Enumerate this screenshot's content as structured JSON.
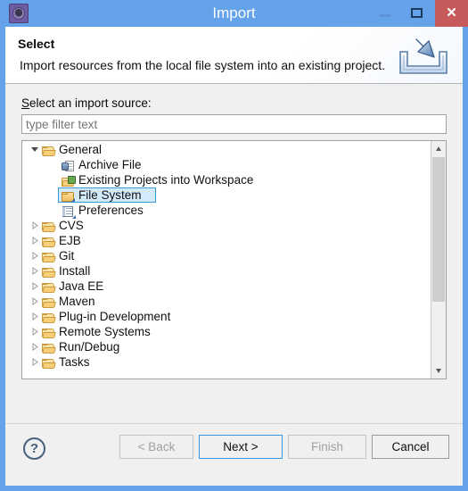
{
  "window": {
    "title": "Import",
    "app_icon": "eclipse-gear-icon",
    "controls": {
      "minimize": "minimize-icon",
      "maximize": "maximize-icon",
      "close": "✕"
    },
    "colors": {
      "titlebar": "#64a2ea",
      "close_button": "#c75b5b",
      "selection_fill": "#d3eafb",
      "selection_border": "#3a9ad9",
      "default_button_border": "#3399e6",
      "body": "#f0f0f0"
    }
  },
  "header": {
    "title": "Select",
    "description": "Import resources from the local file system into an existing project.",
    "banner_icon": "import-arrow-into-tray-icon"
  },
  "source": {
    "label_prefix": "S",
    "label_rest": "elect an import source:",
    "filter_placeholder": "type filter text",
    "filter_value": ""
  },
  "tree": {
    "items": [
      {
        "label": "General",
        "indent": 0,
        "icon": "open-folder-icon",
        "state": "expanded",
        "selected": false
      },
      {
        "label": "Archive File",
        "indent": 1,
        "icon": "archive-file-icon",
        "state": "leaf",
        "selected": false
      },
      {
        "label": "Existing Projects into Workspace",
        "indent": 1,
        "icon": "projects-folder-icon",
        "state": "leaf",
        "selected": false
      },
      {
        "label": "File System",
        "indent": 1,
        "icon": "file-system-folder-icon",
        "state": "leaf",
        "selected": true
      },
      {
        "label": "Preferences",
        "indent": 1,
        "icon": "preferences-doc-icon",
        "state": "leaf",
        "selected": false
      },
      {
        "label": "CVS",
        "indent": 0,
        "icon": "open-folder-icon",
        "state": "collapsed",
        "selected": false
      },
      {
        "label": "EJB",
        "indent": 0,
        "icon": "open-folder-icon",
        "state": "collapsed",
        "selected": false
      },
      {
        "label": "Git",
        "indent": 0,
        "icon": "open-folder-icon",
        "state": "collapsed",
        "selected": false
      },
      {
        "label": "Install",
        "indent": 0,
        "icon": "open-folder-icon",
        "state": "collapsed",
        "selected": false
      },
      {
        "label": "Java EE",
        "indent": 0,
        "icon": "open-folder-icon",
        "state": "collapsed",
        "selected": false
      },
      {
        "label": "Maven",
        "indent": 0,
        "icon": "open-folder-icon",
        "state": "collapsed",
        "selected": false
      },
      {
        "label": "Plug-in Development",
        "indent": 0,
        "icon": "open-folder-icon",
        "state": "collapsed",
        "selected": false
      },
      {
        "label": "Remote Systems",
        "indent": 0,
        "icon": "open-folder-icon",
        "state": "collapsed",
        "selected": false
      },
      {
        "label": "Run/Debug",
        "indent": 0,
        "icon": "open-folder-icon",
        "state": "collapsed",
        "selected": false
      },
      {
        "label": "Tasks",
        "indent": 0,
        "icon": "open-folder-icon",
        "state": "collapsed",
        "selected": false
      }
    ],
    "scrollbar": {
      "up_arrow": "chevron-up-icon",
      "down_arrow": "chevron-down-icon"
    }
  },
  "footer": {
    "help": "?",
    "back": {
      "label": "< Back",
      "mnemonic": "B",
      "enabled": false,
      "default": false
    },
    "next": {
      "label": "Next >",
      "mnemonic": "N",
      "enabled": true,
      "default": true
    },
    "finish": {
      "label": "Finish",
      "mnemonic": "F",
      "enabled": false,
      "default": false
    },
    "cancel": {
      "label": "Cancel",
      "mnemonic": "",
      "enabled": true,
      "default": false
    }
  }
}
